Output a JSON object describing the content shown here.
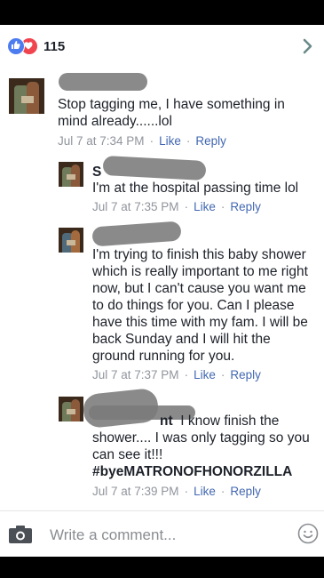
{
  "reactions": {
    "count": "115",
    "icons": [
      "like-icon",
      "love-icon"
    ]
  },
  "comments": [
    {
      "text": "Stop tagging me, I have something in mind already......lol",
      "time": "Jul 7 at 7:34 PM",
      "like": "Like",
      "reply": "Reply"
    },
    {
      "name_initial": "S",
      "text": "I'm at the hospital passing time lol",
      "time": "Jul 7 at 7:35 PM",
      "like": "Like",
      "reply": "Reply"
    },
    {
      "text": "I'm trying to finish this baby shower which is really important to me right now, but I can't cause you want me to do things for you. Can I please have this time with my fam. I will be back Sunday and I will hit the ground running for you.",
      "time": "Jul 7 at 7:37 PM",
      "like": "Like",
      "reply": "Reply"
    },
    {
      "name_end": "nt",
      "text": "I know finish the shower.... I was only tagging so you can see it!!!",
      "hashtag": "#byeMATRONOFHONORZILLA",
      "time": "Jul 7 at 7:39 PM",
      "like": "Like",
      "reply": "Reply"
    }
  ],
  "composer": {
    "placeholder": "Write a comment..."
  }
}
